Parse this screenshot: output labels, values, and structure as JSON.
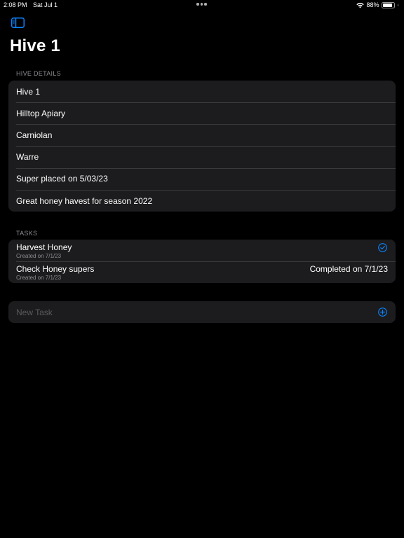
{
  "status_bar": {
    "time": "2:08 PM",
    "date": "Sat Jul 1",
    "battery": "88%",
    "battery_level": 0.88
  },
  "page": {
    "title": "Hive 1"
  },
  "hive_details": {
    "header": "HIVE DETAILS",
    "name": "Hive 1",
    "apiary": "Hilltop Apiary",
    "breed": "Carniolan",
    "hive_type": "Warre",
    "note_super": "Super placed on 5/03/23",
    "note_harvest": "Great honey havest for season 2022"
  },
  "tasks": {
    "header": "TASKS",
    "items": [
      {
        "title": "Harvest Honey",
        "created": "Created on 7/1/23",
        "status_icon": "checkmark-circle-icon"
      },
      {
        "title": "Check Honey supers",
        "created": "Created on 7/1/23",
        "completed": "Completed on 7/1/23"
      }
    ]
  },
  "new_task": {
    "placeholder": "New Task",
    "value": ""
  },
  "colors": {
    "accent": "#0a84ff",
    "background": "#000000",
    "card": "#1c1c1e",
    "secondary_text": "#8d8d93"
  }
}
